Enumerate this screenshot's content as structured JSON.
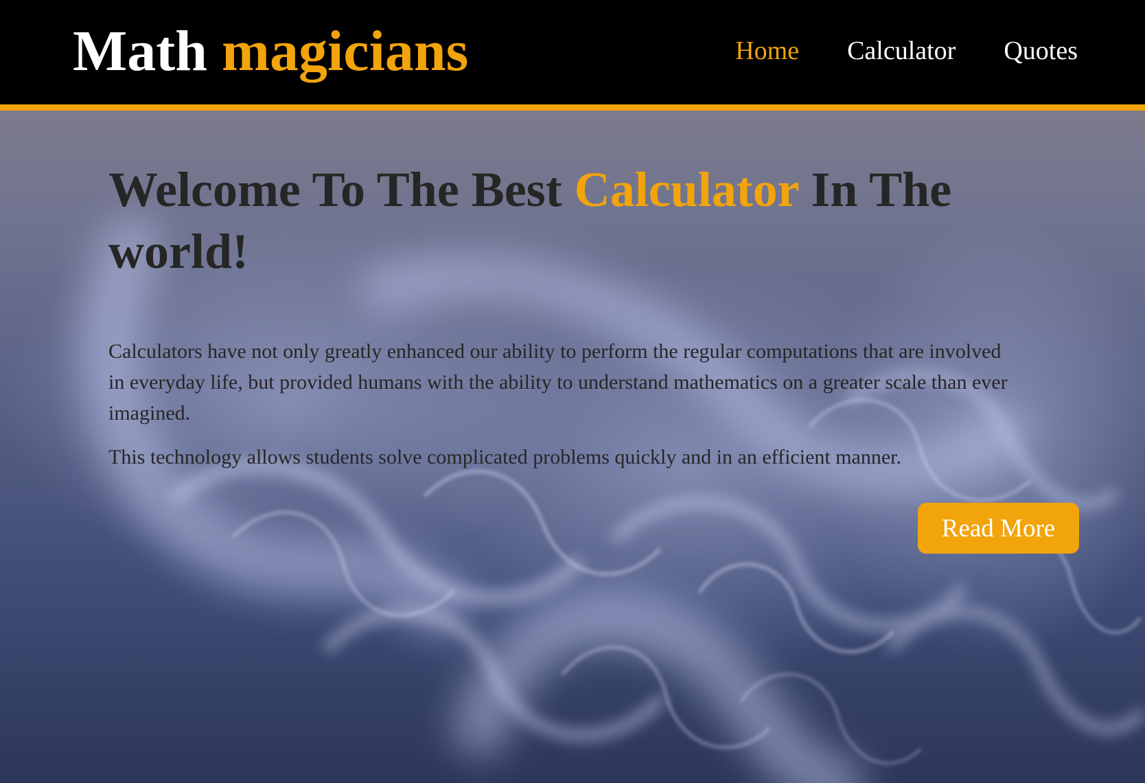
{
  "header": {
    "logo_part1": "Math",
    "logo_part2": "magicians",
    "nav": [
      {
        "label": "Home",
        "active": true
      },
      {
        "label": "Calculator",
        "active": false
      },
      {
        "label": "Quotes",
        "active": false
      }
    ]
  },
  "hero": {
    "title_part1": "Welcome To The Best",
    "title_accent": "Calculator",
    "title_part2": "In The world!",
    "paragraph1": "Calculators have not only greatly enhanced our ability to perform the regular computations that are involved in everyday life, but provided humans with the ability to understand mathematics on a greater scale than ever imagined.",
    "paragraph2": "This technology allows students solve complicated problems quickly and in an efficient manner.",
    "button_label": "Read More"
  },
  "colors": {
    "accent": "#f2a40c",
    "header_bg": "#000000",
    "text_dark": "#262626",
    "background_smoke": "#4a5886"
  }
}
